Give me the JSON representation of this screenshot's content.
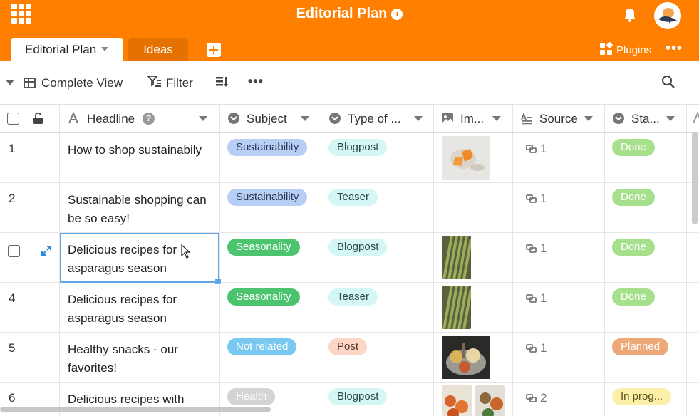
{
  "app": {
    "title": "Editorial Plan",
    "accent_color": "#ff8000"
  },
  "tabs": [
    {
      "label": "Editorial Plan",
      "active": true
    },
    {
      "label": "Ideas",
      "active": false
    }
  ],
  "header_right": {
    "plugins_label": "Plugins"
  },
  "toolbar": {
    "view_label": "Complete View",
    "filter_label": "Filter"
  },
  "columns": [
    {
      "label": "Headline",
      "icon": "text-icon"
    },
    {
      "label": "Subject",
      "icon": "single-select-icon"
    },
    {
      "label": "Type of ...",
      "icon": "single-select-icon"
    },
    {
      "label": "Im...",
      "icon": "image-icon"
    },
    {
      "label": "Source",
      "icon": "long-text-icon"
    },
    {
      "label": "Sta...",
      "icon": "single-select-icon"
    }
  ],
  "rows": [
    {
      "num": "1",
      "headline": "How to shop sustainabily",
      "subject": "Sustainability",
      "type": "Blogpost",
      "source": "1",
      "status": "Done"
    },
    {
      "num": "2",
      "headline": "Sustainable shopping can be so easy!",
      "subject": "Sustainability",
      "type": "Teaser",
      "source": "1",
      "status": "Done"
    },
    {
      "num": "",
      "headline": "Delicious recipes for asparagus season",
      "subject": "Seasonality",
      "type": "Blogpost",
      "source": "1",
      "status": "Done"
    },
    {
      "num": "4",
      "headline": "Delicious recipes for asparagus season",
      "subject": "Seasonality",
      "type": "Teaser",
      "source": "1",
      "status": "Done"
    },
    {
      "num": "5",
      "headline": "Healthy snacks - our favorites!",
      "subject": "Not related",
      "type": "Post",
      "source": "1",
      "status": "Planned"
    },
    {
      "num": "6",
      "headline": "Delicious recipes with",
      "subject": "Health",
      "type": "Blogpost",
      "source": "2",
      "status": "In prog..."
    }
  ],
  "colors": {
    "sustainability": "#b8cff5",
    "seasonality": "#4cc46f",
    "not_related": "#79c8f0",
    "health": "#d4d4d4",
    "type_pill": "#d4f6f4",
    "post_pill": "#fcd7c8",
    "done": "#a6e08c",
    "planned": "#eda878",
    "in_progress": "#fcefa8"
  }
}
